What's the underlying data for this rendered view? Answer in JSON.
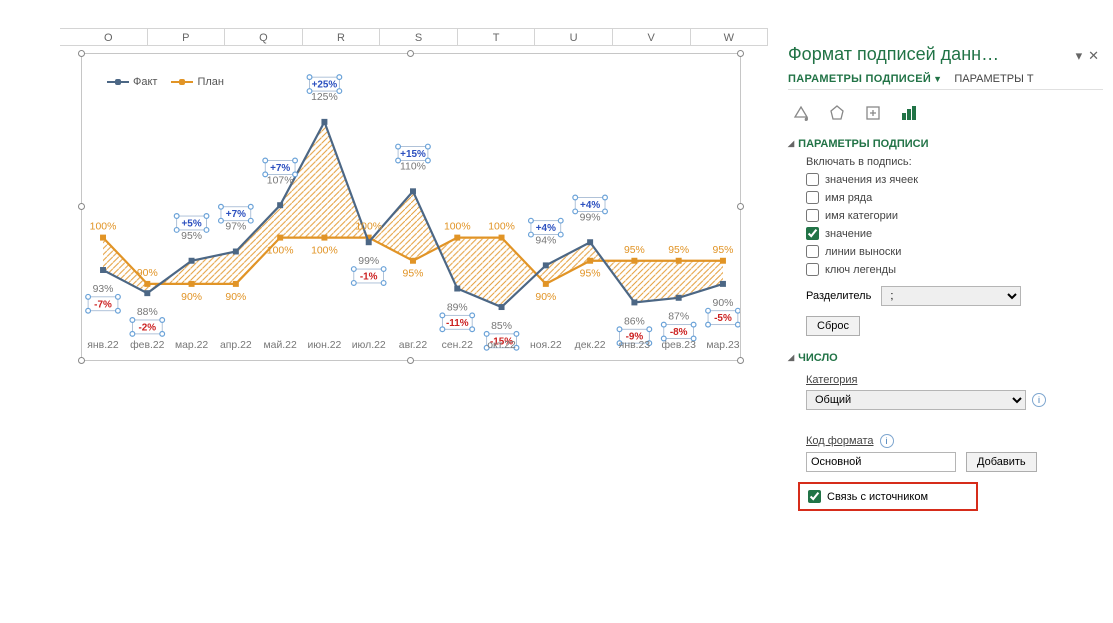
{
  "columns": [
    "O",
    "P",
    "Q",
    "R",
    "S",
    "T",
    "U",
    "V",
    "W"
  ],
  "legend": {
    "fact": "Факт",
    "plan": "План"
  },
  "panel": {
    "title": "Формат подписей данн…",
    "tab_main": "ПАРАМЕТРЫ ПОДПИСЕЙ",
    "tab_sec": "ПАРАМЕТРЫ Т",
    "section1": "ПАРАМЕТРЫ ПОДПИСИ",
    "include_label": "Включать в подпись:",
    "checks": {
      "cells": "значения из ячеек",
      "series": "имя ряда",
      "category": "имя категории",
      "value": "значение",
      "leader": "линии выноски",
      "legend_key": "ключ легенды"
    },
    "separator_label": "Разделитель",
    "separator_value": ";",
    "reset": "Сброс",
    "section2": "ЧИСЛО",
    "category_label": "Категория",
    "category_value": "Общий",
    "fmt_label": "Код формата",
    "fmt_value": "Основной",
    "add": "Добавить",
    "linked": "Связь с источником"
  },
  "chart_data": {
    "type": "line",
    "categories": [
      "янв.22",
      "фев.22",
      "мар.22",
      "апр.22",
      "май.22",
      "июн.22",
      "июл.22",
      "авг.22",
      "сен.22",
      "окт.22",
      "ноя.22",
      "дек.22",
      "янв.23",
      "фев.23",
      "мар.23"
    ],
    "series": [
      {
        "name": "Факт",
        "values": [
          93,
          88,
          95,
          97,
          107,
          125,
          99,
          110,
          89,
          85,
          94,
          99,
          86,
          87,
          90
        ]
      },
      {
        "name": "План",
        "values": [
          100,
          90,
          90,
          90,
          100,
          100,
          100,
          95,
          100,
          100,
          90,
          95,
          95,
          95,
          95
        ]
      }
    ],
    "diff_labels": [
      "-7%",
      "-2%",
      "+5%",
      "+7%",
      "+7%",
      "+25%",
      "-1%",
      "+15%",
      "-11%",
      "-15%",
      "+4%",
      "+4%",
      "-9%",
      "-8%",
      "-5%"
    ],
    "diff_colors": [
      "neg",
      "neg",
      "pos",
      "pos",
      "pos",
      "pos",
      "neg",
      "pos",
      "neg",
      "neg",
      "pos",
      "pos",
      "neg",
      "neg",
      "neg"
    ],
    "ylim": [
      80,
      130
    ]
  }
}
